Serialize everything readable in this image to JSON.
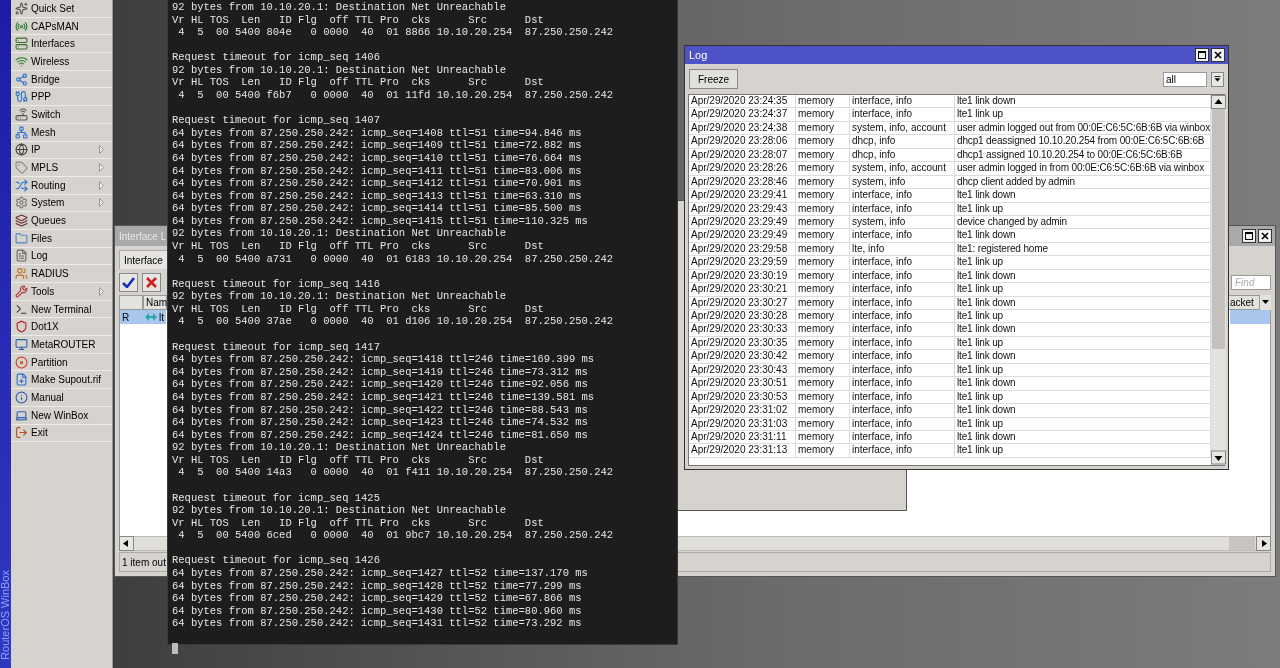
{
  "brand": "RouterOS WinBox",
  "menu": [
    {
      "label": "Quick Set",
      "submenu": false
    },
    {
      "label": "CAPsMAN",
      "submenu": false
    },
    {
      "label": "Interfaces",
      "submenu": false
    },
    {
      "label": "Wireless",
      "submenu": false
    },
    {
      "label": "Bridge",
      "submenu": false
    },
    {
      "label": "PPP",
      "submenu": false
    },
    {
      "label": "Switch",
      "submenu": false
    },
    {
      "label": "Mesh",
      "submenu": false
    },
    {
      "label": "IP",
      "submenu": true
    },
    {
      "label": "MPLS",
      "submenu": true
    },
    {
      "label": "Routing",
      "submenu": true
    },
    {
      "label": "System",
      "submenu": true
    },
    {
      "label": "Queues",
      "submenu": false
    },
    {
      "label": "Files",
      "submenu": false
    },
    {
      "label": "Log",
      "submenu": false
    },
    {
      "label": "RADIUS",
      "submenu": false
    },
    {
      "label": "Tools",
      "submenu": true
    },
    {
      "label": "New Terminal",
      "submenu": false
    },
    {
      "label": "Dot1X",
      "submenu": false
    },
    {
      "label": "MetaROUTER",
      "submenu": false
    },
    {
      "label": "Partition",
      "submenu": false
    },
    {
      "label": "Make Supout.rif",
      "submenu": false
    },
    {
      "label": "Manual",
      "submenu": false
    },
    {
      "label": "New WinBox",
      "submenu": false
    },
    {
      "label": "Exit",
      "submenu": false
    }
  ],
  "interface_window": {
    "title": "Interface L",
    "tabs": [
      {
        "label": "Interface",
        "selected": true
      }
    ],
    "find": {
      "placeholder": "Find"
    },
    "columns": [
      "Nam",
      "acket"
    ],
    "rows": [
      {
        "flag": "R",
        "name": "lt",
        "selected": true
      }
    ],
    "status": "1 item out"
  },
  "terminal": {
    "blocks": [
      [
        "92 bytes from 10.10.20.1: Destination Net Unreachable",
        "Vr HL TOS  Len   ID Flg  off TTL Pro  cks      Src      Dst",
        " 4  5  00 5400 804e   0 0000  40  01 8866 10.10.20.254  87.250.250.242"
      ],
      [
        "Request timeout for icmp_seq 1406",
        "92 bytes from 10.10.20.1: Destination Net Unreachable",
        "Vr HL TOS  Len   ID Flg  off TTL Pro  cks      Src      Dst",
        " 4  5  00 5400 f6b7   0 0000  40  01 11fd 10.10.20.254  87.250.250.242"
      ],
      [
        "Request timeout for icmp_seq 1407",
        "64 bytes from 87.250.250.242: icmp_seq=1408 ttl=51 time=94.846 ms",
        "64 bytes from 87.250.250.242: icmp_seq=1409 ttl=51 time=72.882 ms",
        "64 bytes from 87.250.250.242: icmp_seq=1410 ttl=51 time=76.664 ms",
        "64 bytes from 87.250.250.242: icmp_seq=1411 ttl=51 time=83.006 ms",
        "64 bytes from 87.250.250.242: icmp_seq=1412 ttl=51 time=70.901 ms",
        "64 bytes from 87.250.250.242: icmp_seq=1413 ttl=51 time=63.310 ms",
        "64 bytes from 87.250.250.242: icmp_seq=1414 ttl=51 time=85.500 ms",
        "64 bytes from 87.250.250.242: icmp_seq=1415 ttl=51 time=110.325 ms",
        "92 bytes from 10.10.20.1: Destination Net Unreachable",
        "Vr HL TOS  Len   ID Flg  off TTL Pro  cks      Src      Dst",
        " 4  5  00 5400 a731   0 0000  40  01 6183 10.10.20.254  87.250.250.242"
      ],
      [
        "Request timeout for icmp_seq 1416",
        "92 bytes from 10.10.20.1: Destination Net Unreachable",
        "Vr HL TOS  Len   ID Flg  off TTL Pro  cks      Src      Dst",
        " 4  5  00 5400 37ae   0 0000  40  01 d106 10.10.20.254  87.250.250.242"
      ],
      [
        "Request timeout for icmp_seq 1417",
        "64 bytes from 87.250.250.242: icmp_seq=1418 ttl=246 time=169.399 ms",
        "64 bytes from 87.250.250.242: icmp_seq=1419 ttl=246 time=73.312 ms",
        "64 bytes from 87.250.250.242: icmp_seq=1420 ttl=246 time=92.056 ms",
        "64 bytes from 87.250.250.242: icmp_seq=1421 ttl=246 time=139.581 ms",
        "64 bytes from 87.250.250.242: icmp_seq=1422 ttl=246 time=88.543 ms",
        "64 bytes from 87.250.250.242: icmp_seq=1423 ttl=246 time=74.532 ms",
        "64 bytes from 87.250.250.242: icmp_seq=1424 ttl=246 time=81.650 ms",
        "92 bytes from 10.10.20.1: Destination Net Unreachable",
        "Vr HL TOS  Len   ID Flg  off TTL Pro  cks      Src      Dst",
        " 4  5  00 5400 14a3   0 0000  40  01 f411 10.10.20.254  87.250.250.242"
      ],
      [
        "Request timeout for icmp_seq 1425",
        "92 bytes from 10.10.20.1: Destination Net Unreachable",
        "Vr HL TOS  Len   ID Flg  off TTL Pro  cks      Src      Dst",
        " 4  5  00 5400 6ced   0 0000  40  01 9bc7 10.10.20.254  87.250.250.242"
      ],
      [
        "Request timeout for icmp_seq 1426",
        "64 bytes from 87.250.250.242: icmp_seq=1427 ttl=52 time=137.170 ms",
        "64 bytes from 87.250.250.242: icmp_seq=1428 ttl=52 time=77.299 ms",
        "64 bytes from 87.250.250.242: icmp_seq=1429 ttl=52 time=67.866 ms",
        "64 bytes from 87.250.250.242: icmp_seq=1430 ttl=52 time=80.960 ms",
        "64 bytes from 87.250.250.242: icmp_seq=1431 ttl=52 time=73.292 ms"
      ]
    ]
  },
  "log": {
    "title": "Log",
    "freeze": "Freeze",
    "filter": "all",
    "rows": [
      {
        "time": "Apr/29/2020 23:24:35",
        "buffer": "memory",
        "topics": "interface, info",
        "message": "lte1 link down"
      },
      {
        "time": "Apr/29/2020 23:24:37",
        "buffer": "memory",
        "topics": "interface, info",
        "message": "lte1 link up"
      },
      {
        "time": "Apr/29/2020 23:24:38",
        "buffer": "memory",
        "topics": "system, info, account",
        "message": "user admin logged out from 00:0E:C6:5C:6B:6B via winbox"
      },
      {
        "time": "Apr/29/2020 23:28:06",
        "buffer": "memory",
        "topics": "dhcp, info",
        "message": "dhcp1 deassigned 10.10.20.254 from 00:0E:C6:5C:6B:6B"
      },
      {
        "time": "Apr/29/2020 23:28:07",
        "buffer": "memory",
        "topics": "dhcp, info",
        "message": "dhcp1 assigned 10.10.20.254 to 00:0E:C6:5C:6B:6B"
      },
      {
        "time": "Apr/29/2020 23:28:26",
        "buffer": "memory",
        "topics": "system, info, account",
        "message": "user admin logged in from 00:0E:C6:5C:6B:6B via winbox"
      },
      {
        "time": "Apr/29/2020 23:28:46",
        "buffer": "memory",
        "topics": "system, info",
        "message": "dhcp client added by admin"
      },
      {
        "time": "Apr/29/2020 23:29:41",
        "buffer": "memory",
        "topics": "interface, info",
        "message": "lte1 link down"
      },
      {
        "time": "Apr/29/2020 23:29:43",
        "buffer": "memory",
        "topics": "interface, info",
        "message": "lte1 link up"
      },
      {
        "time": "Apr/29/2020 23:29:49",
        "buffer": "memory",
        "topics": "system, info",
        "message": "device changed by admin"
      },
      {
        "time": "Apr/29/2020 23:29:49",
        "buffer": "memory",
        "topics": "interface, info",
        "message": "lte1 link down"
      },
      {
        "time": "Apr/29/2020 23:29:58",
        "buffer": "memory",
        "topics": "lte, info",
        "message": "lte1: registered home"
      },
      {
        "time": "Apr/29/2020 23:29:59",
        "buffer": "memory",
        "topics": "interface, info",
        "message": "lte1 link up"
      },
      {
        "time": "Apr/29/2020 23:30:19",
        "buffer": "memory",
        "topics": "interface, info",
        "message": "lte1 link down"
      },
      {
        "time": "Apr/29/2020 23:30:21",
        "buffer": "memory",
        "topics": "interface, info",
        "message": "lte1 link up"
      },
      {
        "time": "Apr/29/2020 23:30:27",
        "buffer": "memory",
        "topics": "interface, info",
        "message": "lte1 link down"
      },
      {
        "time": "Apr/29/2020 23:30:28",
        "buffer": "memory",
        "topics": "interface, info",
        "message": "lte1 link up"
      },
      {
        "time": "Apr/29/2020 23:30:33",
        "buffer": "memory",
        "topics": "interface, info",
        "message": "lte1 link down"
      },
      {
        "time": "Apr/29/2020 23:30:35",
        "buffer": "memory",
        "topics": "interface, info",
        "message": "lte1 link up"
      },
      {
        "time": "Apr/29/2020 23:30:42",
        "buffer": "memory",
        "topics": "interface, info",
        "message": "lte1 link down"
      },
      {
        "time": "Apr/29/2020 23:30:43",
        "buffer": "memory",
        "topics": "interface, info",
        "message": "lte1 link up"
      },
      {
        "time": "Apr/29/2020 23:30:51",
        "buffer": "memory",
        "topics": "interface, info",
        "message": "lte1 link down"
      },
      {
        "time": "Apr/29/2020 23:30:53",
        "buffer": "memory",
        "topics": "interface, info",
        "message": "lte1 link up"
      },
      {
        "time": "Apr/29/2020 23:31:02",
        "buffer": "memory",
        "topics": "interface, info",
        "message": "lte1 link down"
      },
      {
        "time": "Apr/29/2020 23:31:03",
        "buffer": "memory",
        "topics": "interface, info",
        "message": "lte1 link up"
      },
      {
        "time": "Apr/29/2020 23:31:11",
        "buffer": "memory",
        "topics": "interface, info",
        "message": "lte1 link down"
      },
      {
        "time": "Apr/29/2020 23:31:13",
        "buffer": "memory",
        "topics": "interface, info",
        "message": "lte1 link up"
      }
    ]
  }
}
